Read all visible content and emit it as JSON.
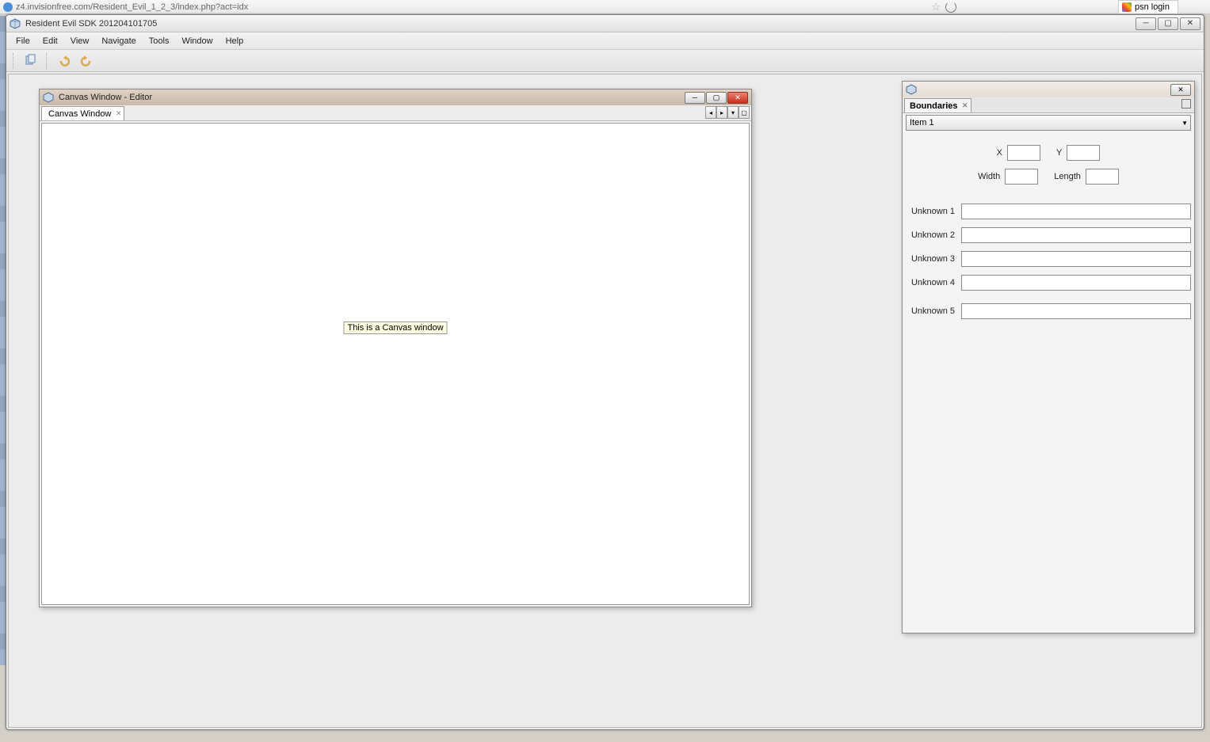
{
  "browser": {
    "url": "z4.invisionfree.com/Resident_Evil_1_2_3/index.php?act=idx",
    "second_tab": "psn login"
  },
  "app": {
    "title": "Resident Evil SDK 201204101705",
    "menu": [
      "File",
      "Edit",
      "View",
      "Navigate",
      "Tools",
      "Window",
      "Help"
    ]
  },
  "canvas_window": {
    "title": "Canvas Window - Editor",
    "tab": "Canvas Window",
    "content_label": "This is a Canvas window"
  },
  "boundaries": {
    "tab": "Boundaries",
    "dropdown": "Item 1",
    "coords": {
      "x_label": "X",
      "x_value": "",
      "y_label": "Y",
      "y_value": "",
      "width_label": "Width",
      "width_value": "",
      "length_label": "Length",
      "length_value": ""
    },
    "unknowns": [
      {
        "label": "Unknown 1",
        "value": ""
      },
      {
        "label": "Unknown 2",
        "value": ""
      },
      {
        "label": "Unknown 3",
        "value": ""
      },
      {
        "label": "Unknown 4",
        "value": ""
      },
      {
        "label": "Unknown 5",
        "value": ""
      }
    ]
  }
}
